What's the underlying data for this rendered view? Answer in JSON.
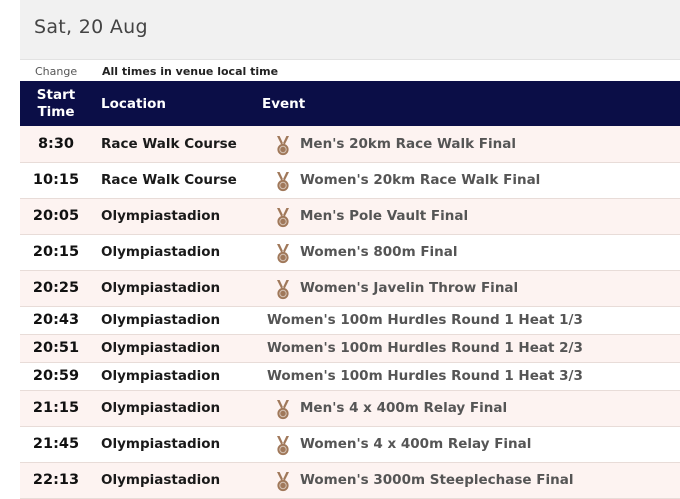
{
  "header": {
    "date": "Sat, 20 Aug"
  },
  "timezone": {
    "change_label": "Change",
    "note": "All times in venue local time"
  },
  "table": {
    "columns": {
      "time_line1": "Start",
      "time_line2": "Time",
      "location": "Location",
      "event": "Event"
    },
    "rows": [
      {
        "time": "8:30",
        "location": "Race Walk Course",
        "event": "Men's 20km Race Walk Final",
        "medal": true
      },
      {
        "time": "10:15",
        "location": "Race Walk Course",
        "event": "Women's 20km Race Walk Final",
        "medal": true
      },
      {
        "time": "20:05",
        "location": "Olympiastadion",
        "event": "Men's Pole Vault Final",
        "medal": true
      },
      {
        "time": "20:15",
        "location": "Olympiastadion",
        "event": "Women's 800m Final",
        "medal": true
      },
      {
        "time": "20:25",
        "location": "Olympiastadion",
        "event": "Women's Javelin Throw Final",
        "medal": true
      },
      {
        "time": "20:43",
        "location": "Olympiastadion",
        "event": "Women's 100m Hurdles Round 1 Heat 1/3",
        "medal": false
      },
      {
        "time": "20:51",
        "location": "Olympiastadion",
        "event": "Women's 100m Hurdles Round 1 Heat 2/3",
        "medal": false
      },
      {
        "time": "20:59",
        "location": "Olympiastadion",
        "event": "Women's 100m Hurdles Round 1 Heat 3/3",
        "medal": false
      },
      {
        "time": "21:15",
        "location": "Olympiastadion",
        "event": "Men's 4 x 400m Relay Final",
        "medal": true
      },
      {
        "time": "21:45",
        "location": "Olympiastadion",
        "event": "Women's 4 x 400m Relay Final",
        "medal": true
      },
      {
        "time": "22:13",
        "location": "Olympiastadion",
        "event": "Women's 3000m Steeplechase Final",
        "medal": true
      }
    ]
  },
  "colors": {
    "header_bg": "#0b0e47",
    "row_alt_bg": "#fdf3f1",
    "medal": "#a0785a"
  },
  "icons": {
    "medal": "medal-icon"
  }
}
